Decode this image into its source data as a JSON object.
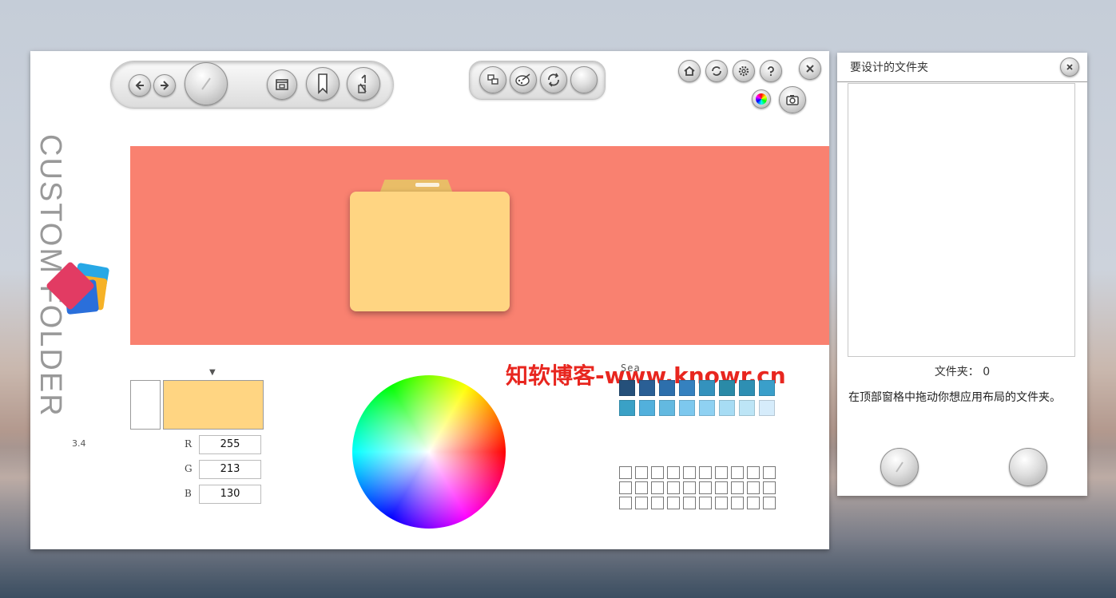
{
  "app": {
    "title_vertical": "CUSTOM FOLDER",
    "version": "3.4",
    "watermark": "知软博客-www.knowr.cn"
  },
  "toolbar": {
    "left_group": [
      "back-icon",
      "forward-icon",
      "apply-icon",
      "window-icon",
      "bookmark-icon",
      "undo-icon"
    ],
    "middle_group": [
      "layers-icon",
      "palette-icon",
      "refresh-arrows-icon",
      "blank-icon"
    ],
    "right_group": [
      "home-icon",
      "sync-icon",
      "settings-icon",
      "help-icon",
      "close-icon"
    ],
    "extra": [
      "color-wheel-icon",
      "camera-icon"
    ]
  },
  "preview": {
    "background": "#f98170",
    "folder_color": "#ffd582"
  },
  "color": {
    "r_label": "R",
    "g_label": "G",
    "b_label": "B",
    "r": "255",
    "g": "213",
    "b": "130",
    "current": "#ffd582",
    "indicator": "▼"
  },
  "palette": {
    "name": "Sea",
    "colors": [
      "#25507a",
      "#2a5f95",
      "#2d6fac",
      "#3581bf",
      "#3492bd",
      "#2a8aa7",
      "#2e8fb3",
      "#3a9fca",
      "#3aa1c6",
      "#52b0dc",
      "#63b9e0",
      "#7dc8ee",
      "#8fd1f2",
      "#a7dcf4",
      "#bde5f6",
      "#d6ecfb"
    ]
  },
  "side_panel": {
    "title": "要设计的文件夹",
    "count_text": "文件夹： 0",
    "hint": "在顶部窗格中拖动你想应用布局的文件夹。"
  }
}
